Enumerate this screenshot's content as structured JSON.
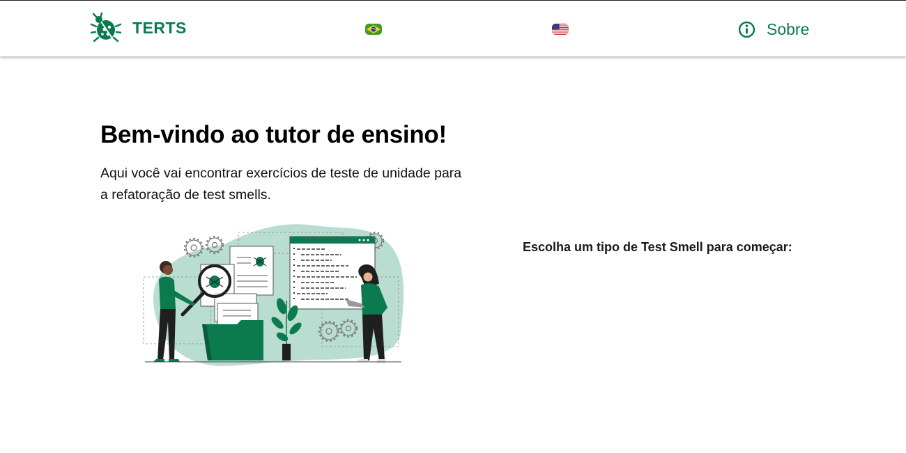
{
  "header": {
    "brand_name": "TERTS",
    "brand_icon": "ladybug-icon",
    "languages": [
      {
        "code": "pt-BR",
        "icon": "brazil-flag-icon"
      },
      {
        "code": "en-US",
        "icon": "usa-flag-icon"
      }
    ],
    "about_label": "Sobre",
    "about_icon": "info-circle-icon"
  },
  "main": {
    "title": "Bem-vindo ao tutor de ensino!",
    "description": "Aqui você vai encontrar exercícios de teste de unidade para a refatoração de test smells.",
    "choose_prompt": "Escolha um tipo de Test Smell para começar:"
  },
  "colors": {
    "brand_green": "#0c7a4f",
    "light_green": "#b9ddd0",
    "dark_text": "#111111"
  }
}
